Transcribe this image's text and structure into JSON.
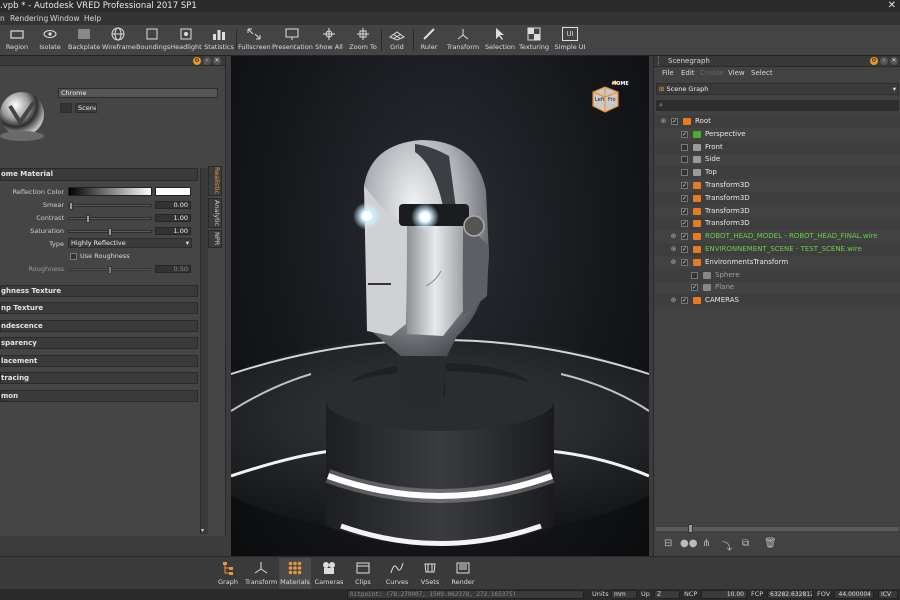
{
  "titlebar": {
    "title": ".vpb * - Autodesk VRED Professional 2017 SP1",
    "close": "✕"
  },
  "menubar": {
    "items": [
      "n",
      "Rendering",
      "Window",
      "Help"
    ]
  },
  "toolbar": {
    "items": [
      "Region",
      "Isolate",
      "Backplate",
      "Wireframe",
      "Boundings",
      "Headlight",
      "Statistics",
      "Fullscreen",
      "Presentation",
      "Show All",
      "Zoom To",
      "Grid",
      "Ruler",
      "Transform",
      "Selection",
      "Texturing",
      "Simple UI"
    ],
    "simple_ui_icon_text": "UI"
  },
  "material_editor": {
    "material_name": "Chrome",
    "scene_label": "Scene",
    "sections_top": "ome Material",
    "reflection_color_label": "Reflection Color",
    "smear": {
      "label": "Smear",
      "value": "0.00",
      "level": 0.0
    },
    "contrast": {
      "label": "Contrast",
      "value": "1.00",
      "level": 0.22
    },
    "saturation": {
      "label": "Saturation",
      "value": "1.00",
      "level": 0.5
    },
    "type": {
      "label": "Type",
      "value": "Highly Reflective"
    },
    "use_roughness": "Use Roughness",
    "roughness": {
      "label": "Roughness",
      "value": "0.50",
      "level": 0.5
    },
    "sections": [
      "ghness Texture",
      "np Texture",
      "ndescence",
      "sparency",
      "lacement",
      "tracing",
      "mon"
    ],
    "vertical_tabs": [
      "Realistic",
      "Analytic",
      "NPR"
    ]
  },
  "viewport": {
    "viewcube_home": "HOME",
    "viewcube_left": "Left",
    "viewcube_right": "Fro"
  },
  "scenegraph": {
    "title": "Scenegraph",
    "menu": [
      "File",
      "Edit",
      "Create",
      "View",
      "Select"
    ],
    "dropdown": "Scene Graph",
    "nodes": [
      {
        "label": "Root",
        "color": "#e8e8e8",
        "icon": "#e87a20",
        "checked": true
      },
      {
        "label": "Perspective",
        "color": "#e8e8e8",
        "icon": "#4caf2a",
        "checked": true
      },
      {
        "label": "Front",
        "color": "#e8e8e8",
        "icon": "#9a9a9a",
        "checked": false
      },
      {
        "label": "Side",
        "color": "#e8e8e8",
        "icon": "#9a9a9a",
        "checked": false
      },
      {
        "label": "Top",
        "color": "#e8e8e8",
        "icon": "#9a9a9a",
        "checked": false
      },
      {
        "label": "Transform3D",
        "color": "#e8e8e8",
        "icon": "#e87a20",
        "checked": true
      },
      {
        "label": "Transform3D",
        "color": "#e8e8e8",
        "icon": "#e87a20",
        "checked": true
      },
      {
        "label": "Transform3D",
        "color": "#e8e8e8",
        "icon": "#e87a20",
        "checked": true
      },
      {
        "label": "Transform3D",
        "color": "#e8e8e8",
        "icon": "#e87a20",
        "checked": true
      },
      {
        "label": "ROBOT_HEAD_MODEL - ROBOT_HEAD_FINAL.wire",
        "color": "#6bcf4a",
        "icon": "#e87a20",
        "checked": true
      },
      {
        "label": "ENVIRONNEMENT_SCENE - TEST_SCENE.wire",
        "color": "#6bcf4a",
        "icon": "#e87a20",
        "checked": true
      },
      {
        "label": "EnvironmentsTransform",
        "color": "#e8e8e8",
        "icon": "#e87a20",
        "checked": true
      },
      {
        "label": "Sphere",
        "color": "#a0a0a0",
        "icon": "#888888",
        "checked": false
      },
      {
        "label": "Plane",
        "color": "#a0a0a0",
        "icon": "#888888",
        "checked": true
      },
      {
        "label": "CAMERAS",
        "color": "#e8e8e8",
        "icon": "#e87a20",
        "checked": true
      }
    ]
  },
  "bottombar": {
    "items": [
      "Graph",
      "Transform",
      "Materials",
      "Cameras",
      "Clips",
      "Curves",
      "VSets",
      "Render"
    ]
  },
  "statusbar": {
    "hitpoint": "hitpoint: (78.279907, 1509.062378, 272.165375)",
    "units_label": "Units",
    "units_value": "mm",
    "up_label": "Up",
    "up_value": "Z",
    "ncp_label": "NCP",
    "ncp_value": "10.00",
    "fcp_label": "FCP",
    "fcp_value": "63282.632812",
    "fov_label": "FOV",
    "fov_value": "44.000004",
    "icv": "ICV"
  }
}
